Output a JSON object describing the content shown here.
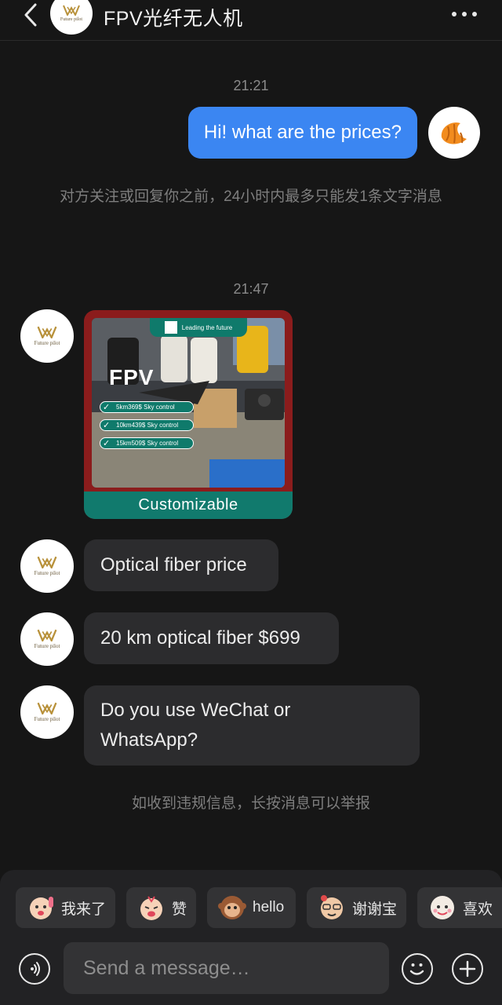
{
  "header": {
    "title": "FPV光纤无人机",
    "avatar_logo_text": "Future pilot",
    "back_icon": "chevron-left-icon",
    "more_icon": "more-dots-icon"
  },
  "messages": {
    "time1": "21:21",
    "outgoing1": "Hi! what are the prices?",
    "notice1": "对方关注或回复你之前，24小时内最多只能发1条文字消息",
    "time2": "21:47",
    "ad": {
      "banner": "Leading the future",
      "fpv": "FPV",
      "rows": [
        "5km369$ Sky control",
        "10km439$ Sky control",
        "15km509$ Sky control"
      ],
      "footer": "Customizable"
    },
    "incoming1": "Optical fiber price",
    "incoming2": "20 km optical fiber $699",
    "incoming3": "Do you use WeChat or WhatsApp?",
    "notice2": "如收到违规信息，长按消息可以举报"
  },
  "peer": {
    "logo_text": "Future pilot"
  },
  "quick_replies": [
    {
      "label": "我来了",
      "icon": "sticker-icon"
    },
    {
      "label": "赞",
      "icon": "sticker-icon"
    },
    {
      "label": "hello",
      "icon": "monkey-sticker-icon"
    },
    {
      "label": "谢谢宝",
      "icon": "sticker-icon"
    },
    {
      "label": "喜欢",
      "icon": "sticker-icon"
    }
  ],
  "composer": {
    "placeholder": "Send a message…",
    "voice_icon": "voice-icon",
    "emoji_icon": "emoji-icon",
    "plus_icon": "plus-icon"
  },
  "colors": {
    "background": "#161616",
    "outgoing_bubble": "#3b86f2",
    "incoming_bubble": "#2c2c2e",
    "panel": "#222224"
  }
}
